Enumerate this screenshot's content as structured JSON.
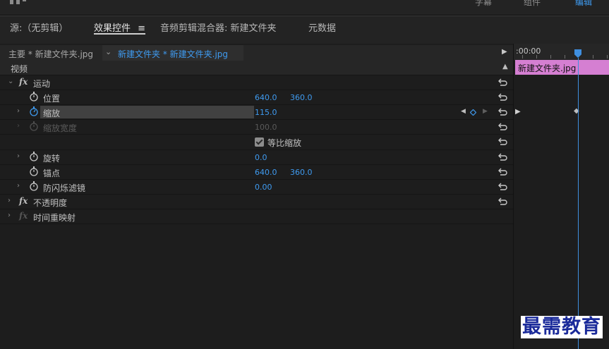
{
  "top_menu": {
    "items": [
      "字幕",
      "组件",
      "编辑"
    ]
  },
  "panel_tabs": [
    {
      "label": "源:（无剪辑）",
      "active": false
    },
    {
      "label": "效果控件",
      "active": true
    },
    {
      "label": "音频剪辑混合器: 新建文件夹",
      "active": false
    },
    {
      "label": "元数据",
      "active": false
    }
  ],
  "panel_menu_icon": "≡",
  "sequence_bar": {
    "master_label": "主要 * 新建文件夹.jpg",
    "clip_label": "新建文件夹 * 新建文件夹.jpg"
  },
  "section": {
    "video_label": "视频"
  },
  "effects": {
    "motion": {
      "label": "运动",
      "properties": [
        {
          "label": "位置",
          "values": [
            "640.0",
            "360.0"
          ],
          "expandable": false,
          "disabled": false,
          "animating": false
        },
        {
          "label": "缩放",
          "values": [
            "115.0"
          ],
          "expandable": true,
          "disabled": false,
          "animating": true
        },
        {
          "label": "缩放宽度",
          "values": [
            "100.0"
          ],
          "expandable": true,
          "disabled": true,
          "animating": false
        },
        {
          "label": "旋转",
          "values": [
            "0.0"
          ],
          "expandable": true,
          "disabled": false,
          "animating": false
        },
        {
          "label": "锚点",
          "values": [
            "640.0",
            "360.0"
          ],
          "expandable": false,
          "disabled": false,
          "animating": false
        },
        {
          "label": "防闪烁滤镜",
          "values": [
            "0.00"
          ],
          "expandable": true,
          "disabled": false,
          "animating": false
        }
      ],
      "uniform_scale": {
        "label": "等比缩放",
        "checked": true
      }
    },
    "opacity": {
      "label": "不透明度"
    },
    "time_remap": {
      "label": "时间重映射"
    }
  },
  "timeline": {
    "timecode": ":00:00",
    "clip_label": "新建文件夹.jpg",
    "clip_color": "#d57fd2",
    "playhead_color": "#3f8fe0"
  },
  "colors": {
    "accent": "#3f9bf0",
    "panel_bg": "#1d1d1d",
    "header_bg": "#262626"
  },
  "watermark": "最需教育"
}
